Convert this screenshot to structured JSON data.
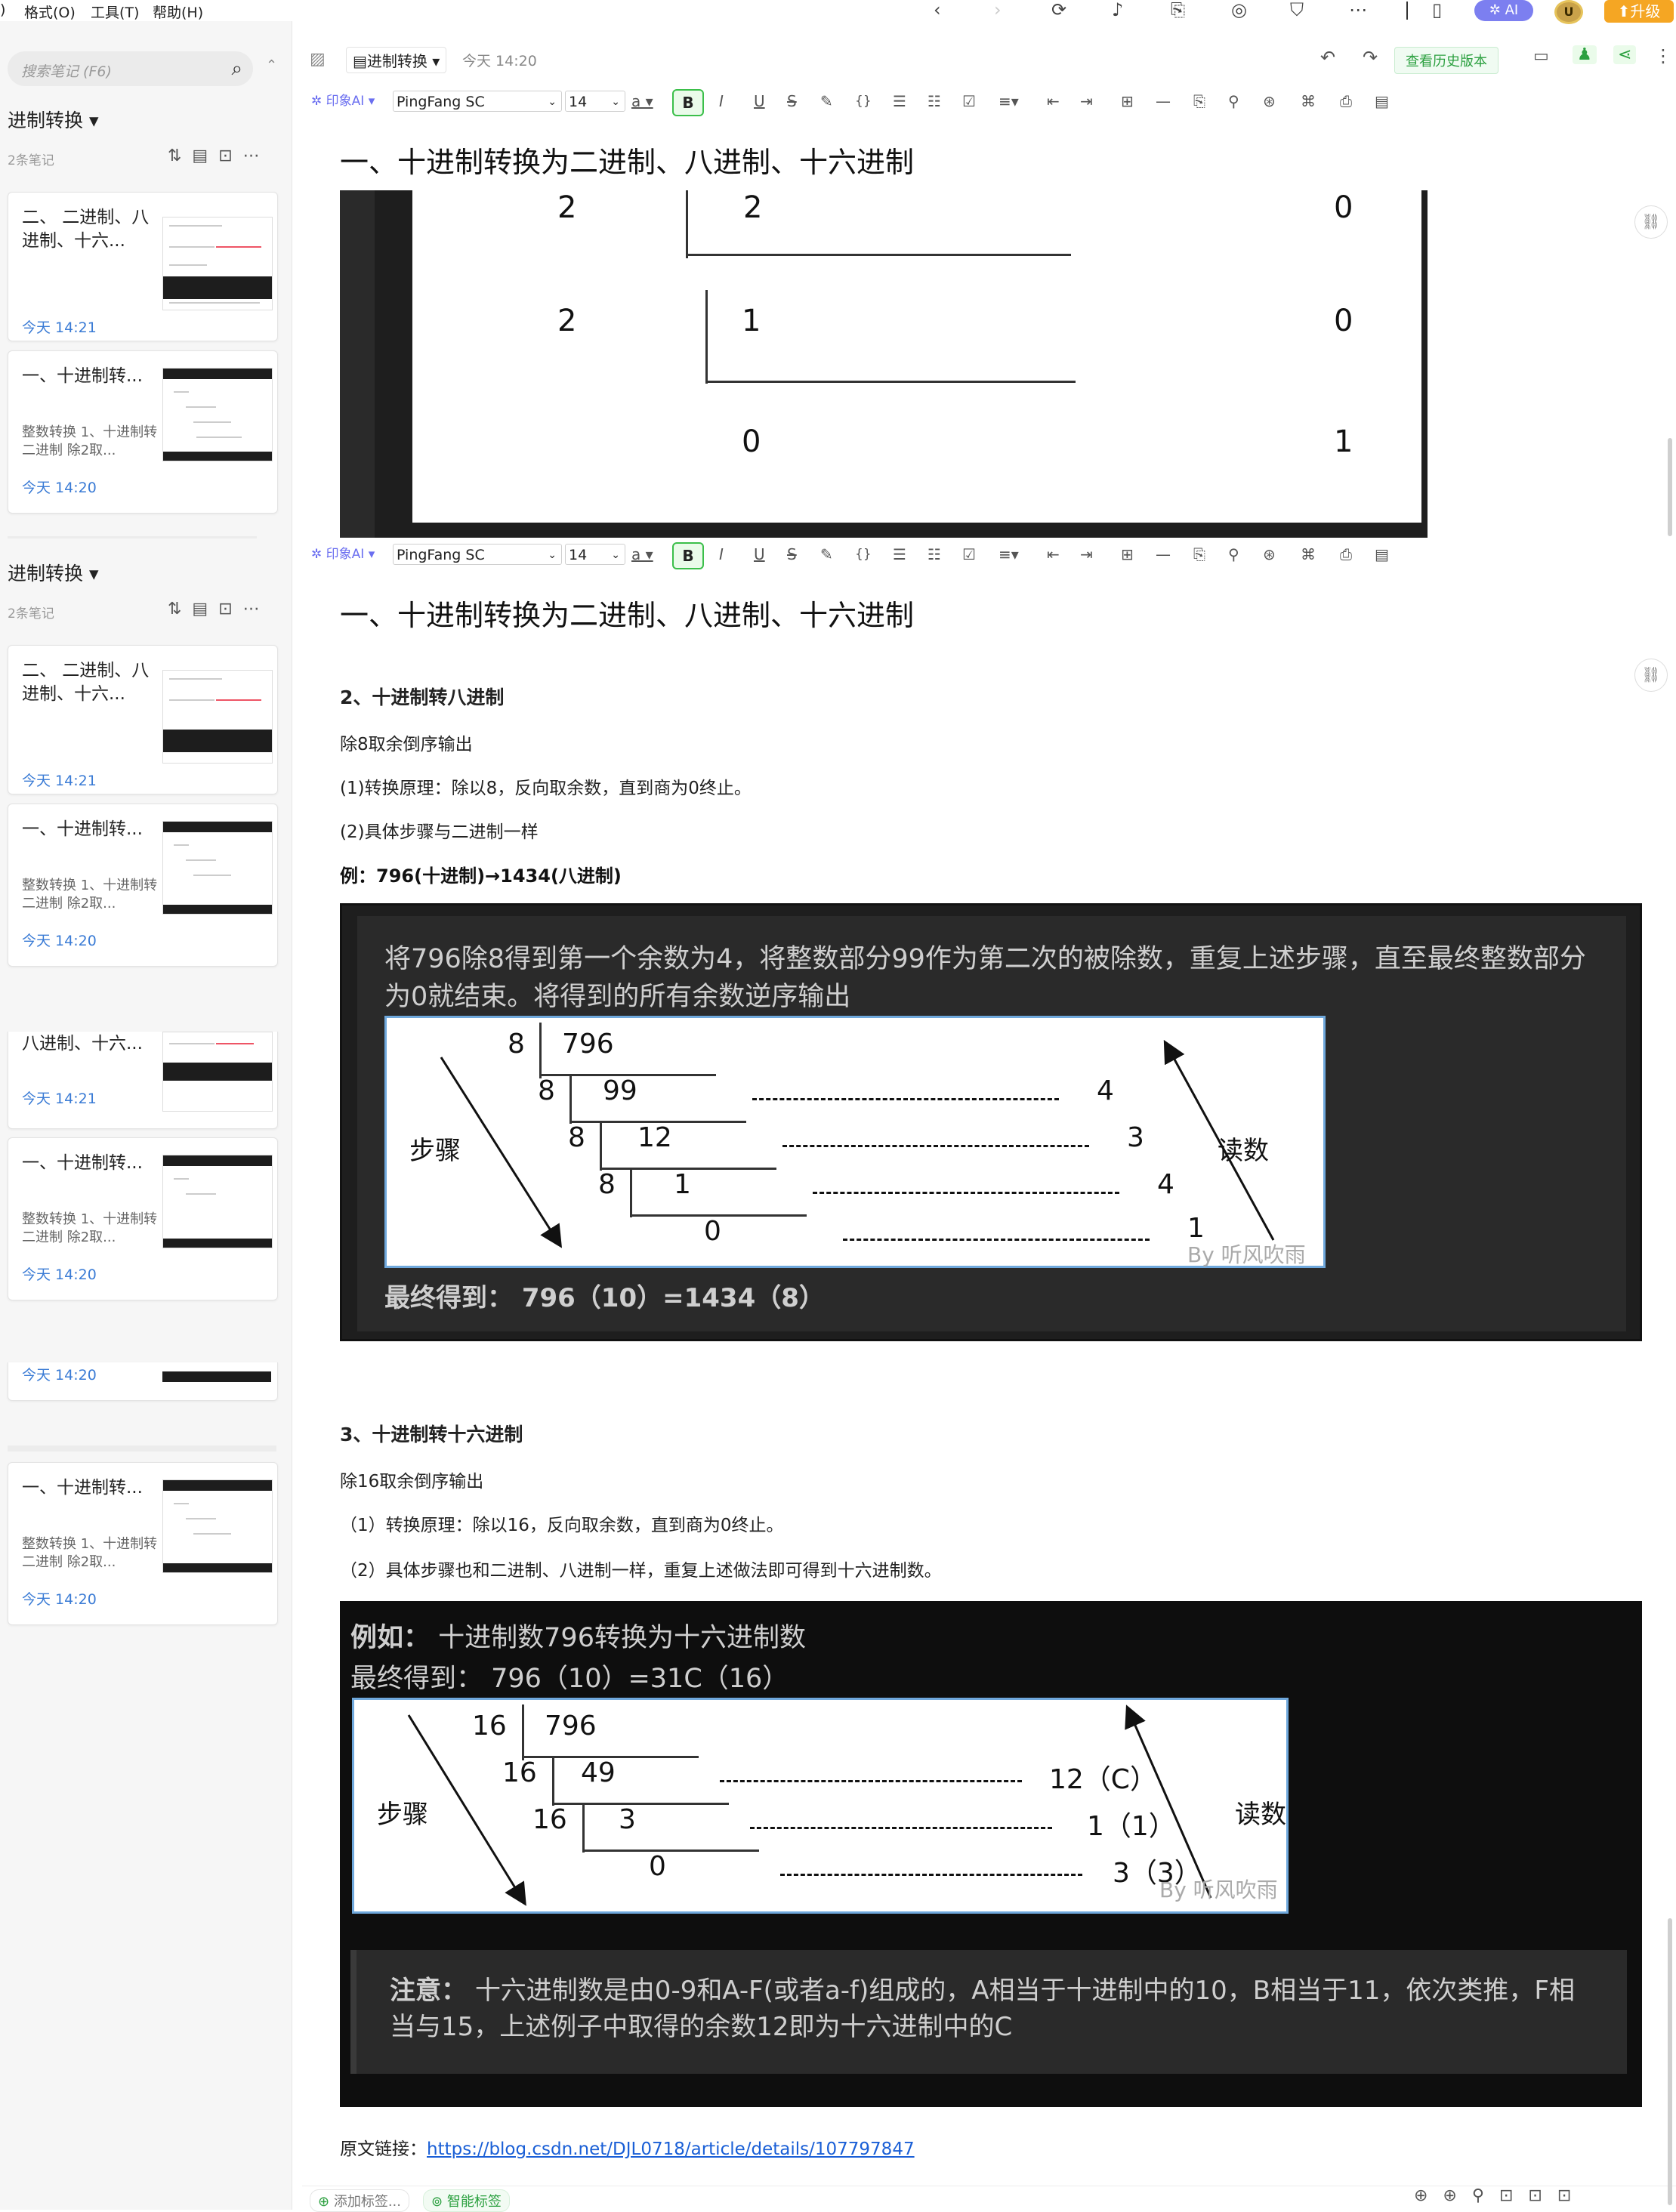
{
  "menu": {
    "format": "格式(O)",
    "tools": "工具(T)",
    "help": "帮助(H)"
  },
  "top_right": {
    "ai": "AI",
    "upgrade": "升级",
    "avatar": "U"
  },
  "sidebar": {
    "search_placeholder": "搜索笔记 (F6)",
    "notebook_title": "进制转换",
    "note_count": "2条笔记",
    "cards": [
      {
        "title": "二、 二进制、八进制、十六...",
        "date": "今天 14:21",
        "snippet": ""
      },
      {
        "title": "一、十进制转...",
        "date": "今天 14:20",
        "snippet": "整数转换 1、十进制转二进制 除2取..."
      }
    ],
    "partial_title": "八进制、十六...",
    "partial_date": "今天 14:21"
  },
  "editor": {
    "notebook_tag": "进制转换",
    "timestamp": "今天 14:20",
    "history_btn": "查看历史版本",
    "toolbar": {
      "ai": "印象AI",
      "font": "PingFang SC",
      "size": "14",
      "bold": "B"
    }
  },
  "content": {
    "h1": "一、十进制转换为二进制、八进制、十六进制",
    "fig1": {
      "rows": [
        {
          "div": "2",
          "quot": "2",
          "rem": "0"
        },
        {
          "div": "2",
          "quot": "1",
          "rem": "0"
        },
        {
          "div": "",
          "quot": "0",
          "rem": "1"
        }
      ]
    },
    "s2": {
      "title": "2、十进制转八进制",
      "line1": "除8取余倒序输出",
      "line2": "(1)转换原理：除以8，反向取余数，直到商为0终止。",
      "line3": "(2)具体步骤与二进制一样",
      "example": "例：796(十进制)→1434(八进制)",
      "box_text_1": "将796除8得到第一个余数为4，将整数部分99作为第二次的被除数，重复上述步骤，直至最终整数部分",
      "box_text_2": "为0就结束。将得到的所有余数逆序输出",
      "steps_label": "步骤",
      "read_label": "读数",
      "watermark": "By 听风吹雨",
      "divs": [
        "8",
        "8",
        "8",
        "8"
      ],
      "values": [
        "796",
        "99",
        "12",
        "1",
        "0"
      ],
      "rems": [
        "4",
        "3",
        "4",
        "1"
      ],
      "result": "最终得到： 796（10）=1434（8）"
    },
    "s3": {
      "title": "3、十进制转十六进制",
      "line1": "除16取余倒序输出",
      "line2": "（1）转换原理：除以16，反向取余数，直到商为0终止。",
      "line3": "（2）具体步骤也和二进制、八进制一样，重复上述做法即可得到十六进制数。",
      "box_label": "例如：",
      "box_text": "十进制数796转换为十六进制数",
      "box_result": "最终得到： 796（10）=31C（16）",
      "steps_label": "步骤",
      "read_label": "读数",
      "watermark": "By 听风吹雨",
      "divs": [
        "16",
        "16",
        "16"
      ],
      "values": [
        "796",
        "49",
        "3",
        "0"
      ],
      "rems": [
        "12（C）",
        "1（1）",
        "3（3）"
      ],
      "note_label": "注意：",
      "note_1": "十六进制数是由0-9和A-F(或者a-f)组成的，A相当于十进制中的10，B相当于11，依次类推，F相",
      "note_2": "当与15，上述例子中取得的余数12即为十六进制中的C"
    },
    "source_label": "原文链接：",
    "source_url": "https://blog.csdn.net/DJL0718/article/details/107797847"
  },
  "footer": {
    "add_tag": "添加标签...",
    "smart_tag": "智能标签"
  }
}
